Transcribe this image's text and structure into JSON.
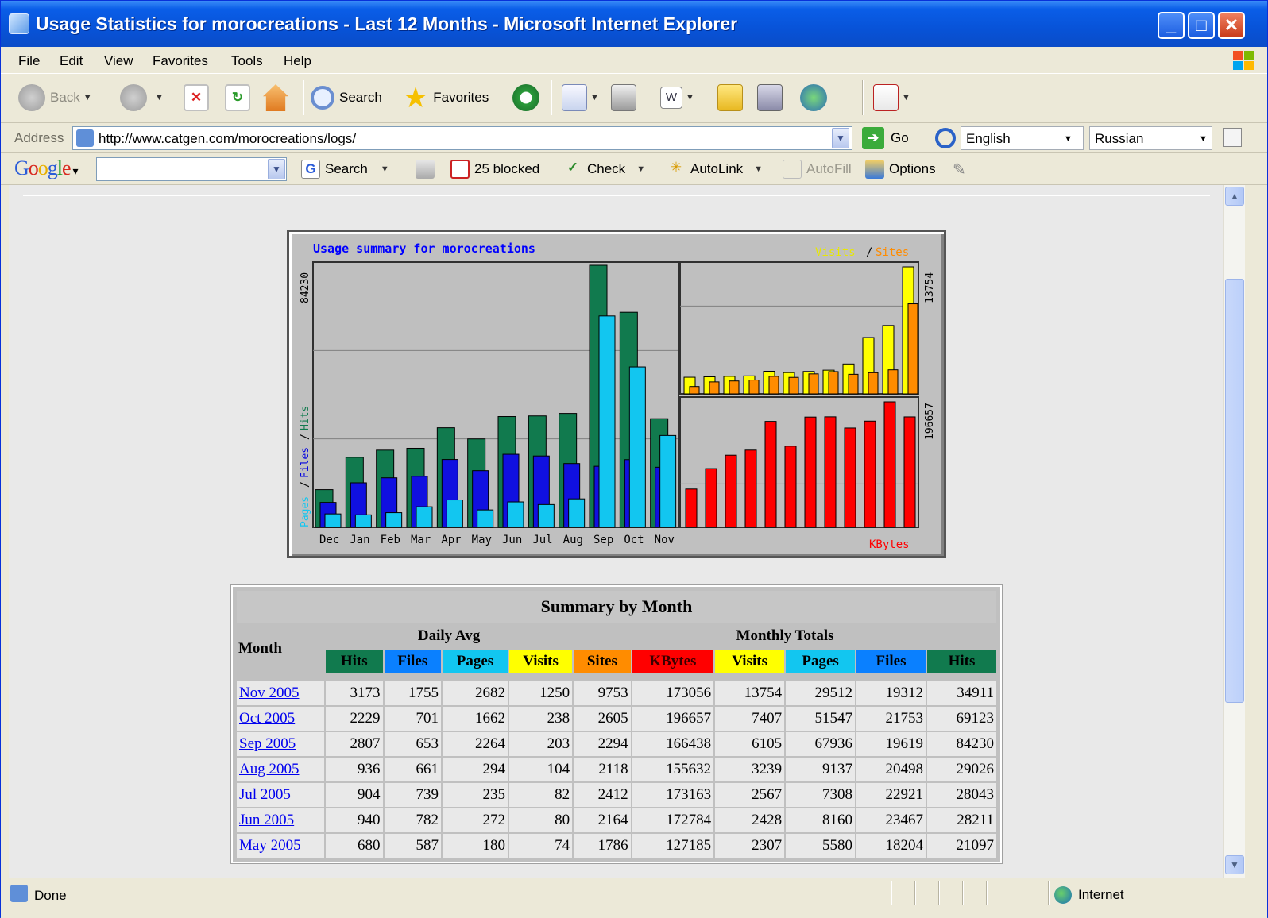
{
  "window": {
    "title": "Usage Statistics for morocreations - Last 12 Months - Microsoft Internet Explorer",
    "minimize": "_",
    "maximize": "□",
    "close": "✕"
  },
  "menu": [
    "File",
    "Edit",
    "View",
    "Favorites",
    "Tools",
    "Help"
  ],
  "toolbar": {
    "back": "Back",
    "search": "Search",
    "favorites": "Favorites"
  },
  "address": {
    "label": "Address",
    "url": "http://www.catgen.com/morocreations/logs/",
    "go": "Go",
    "lang_from": "English",
    "lang_to": "Russian"
  },
  "google": {
    "logo": "Google",
    "search_value": "",
    "search": "Search",
    "blocked": "25 blocked",
    "check": "Check",
    "autolink": "AutoLink",
    "autofill": "AutoFill",
    "options": "Options"
  },
  "chart_data": {
    "type": "bar",
    "title": "Usage summary for morocreations",
    "categories": [
      "Dec",
      "Jan",
      "Feb",
      "Mar",
      "Apr",
      "May",
      "Jun",
      "Jul",
      "Aug",
      "Sep",
      "Oct",
      "Nov"
    ],
    "left": {
      "axis_label_pages": "Pages",
      "axis_label_files": "Files",
      "axis_label_hits": "Hits",
      "max": 84230,
      "max_label": "84230",
      "series": [
        {
          "name": "Hits",
          "color": "#117a4e",
          "values": [
            12100,
            22500,
            24800,
            25400,
            32000,
            28400,
            35600,
            35800,
            36600,
            84230,
            69123,
            34911
          ]
        },
        {
          "name": "Files",
          "color": "#1010e0",
          "values": [
            8000,
            14300,
            15900,
            16400,
            21800,
            18204,
            23467,
            22921,
            20498,
            19619,
            21753,
            19312
          ]
        },
        {
          "name": "Pages",
          "color": "#12c6f0",
          "values": [
            4300,
            4000,
            4700,
            6600,
            8800,
            5580,
            8160,
            7308,
            9137,
            67936,
            51547,
            29512
          ]
        }
      ]
    },
    "top_right": {
      "legend_visits": "Visits",
      "legend_sites": "Sites",
      "max": 13754,
      "max_label": "13754",
      "series": [
        {
          "name": "Visits",
          "color": "#ffff00",
          "values": [
            1800,
            1850,
            1900,
            1950,
            2450,
            2307,
            2428,
            2567,
            3239,
            6105,
            7407,
            13754
          ]
        },
        {
          "name": "Sites",
          "color": "#ff8c00",
          "values": [
            800,
            1300,
            1400,
            1500,
            1900,
            1786,
            2164,
            2412,
            2118,
            2294,
            2605,
            9753
          ]
        }
      ]
    },
    "bottom_right": {
      "legend_kbytes": "KBytes",
      "max": 196657,
      "max_label": "196657",
      "series": [
        {
          "name": "KBytes",
          "color": "#ff0000",
          "values": [
            60000,
            92000,
            113000,
            121000,
            166000,
            127185,
            172784,
            173163,
            155632,
            166438,
            196657,
            173056
          ]
        }
      ]
    }
  },
  "summary": {
    "title": "Summary by Month",
    "month_header": "Month",
    "daily_avg": "Daily Avg",
    "monthly_totals": "Monthly Totals",
    "daily_cols": [
      "Hits",
      "Files",
      "Pages",
      "Visits"
    ],
    "monthly_cols": [
      "Sites",
      "KBytes",
      "Visits",
      "Pages",
      "Files",
      "Hits"
    ],
    "col_colors": [
      "#117a4e",
      "#0a80ff",
      "#12c6f0",
      "#ffff00",
      "#ff8c00",
      "#ff0000",
      "#ffff00",
      "#12c6f0",
      "#0a80ff",
      "#117a4e"
    ],
    "rows": [
      [
        "Nov 2005",
        "3173",
        "1755",
        "2682",
        "1250",
        "9753",
        "173056",
        "13754",
        "29512",
        "19312",
        "34911"
      ],
      [
        "Oct 2005",
        "2229",
        "701",
        "1662",
        "238",
        "2605",
        "196657",
        "7407",
        "51547",
        "21753",
        "69123"
      ],
      [
        "Sep 2005",
        "2807",
        "653",
        "2264",
        "203",
        "2294",
        "166438",
        "6105",
        "67936",
        "19619",
        "84230"
      ],
      [
        "Aug 2005",
        "936",
        "661",
        "294",
        "104",
        "2118",
        "155632",
        "3239",
        "9137",
        "20498",
        "29026"
      ],
      [
        "Jul 2005",
        "904",
        "739",
        "235",
        "82",
        "2412",
        "173163",
        "2567",
        "7308",
        "22921",
        "28043"
      ],
      [
        "Jun 2005",
        "940",
        "782",
        "272",
        "80",
        "2164",
        "172784",
        "2428",
        "8160",
        "23467",
        "28211"
      ],
      [
        "May 2005",
        "680",
        "587",
        "180",
        "74",
        "1786",
        "127185",
        "2307",
        "5580",
        "18204",
        "21097"
      ]
    ]
  },
  "status": {
    "text": "Done",
    "zone": "Internet"
  }
}
